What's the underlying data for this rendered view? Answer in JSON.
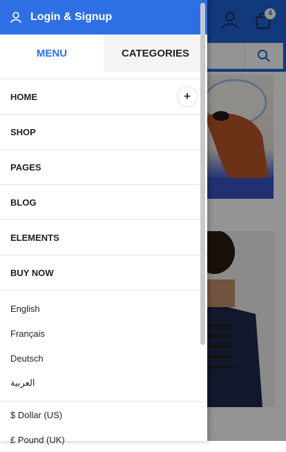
{
  "login": {
    "label": "Login & Signup"
  },
  "tabs": [
    {
      "label": "MENU",
      "active": true
    },
    {
      "label": "CATEGORIES",
      "active": false
    }
  ],
  "menu": [
    {
      "label": "HOME",
      "expandable": true,
      "expand_symbol": "+"
    },
    {
      "label": "SHOP"
    },
    {
      "label": "PAGES"
    },
    {
      "label": "BLOG"
    },
    {
      "label": "ELEMENTS"
    },
    {
      "label": "BUY NOW"
    }
  ],
  "languages": [
    "English",
    "Français",
    "Deutsch",
    "العربية"
  ],
  "currencies": [
    "$ Dollar (US)",
    "£ Pound (UK)"
  ],
  "header": {
    "cart_count": "4"
  },
  "colors": {
    "accent": "#2f6fe4",
    "header_bg": "#1e63d6"
  }
}
